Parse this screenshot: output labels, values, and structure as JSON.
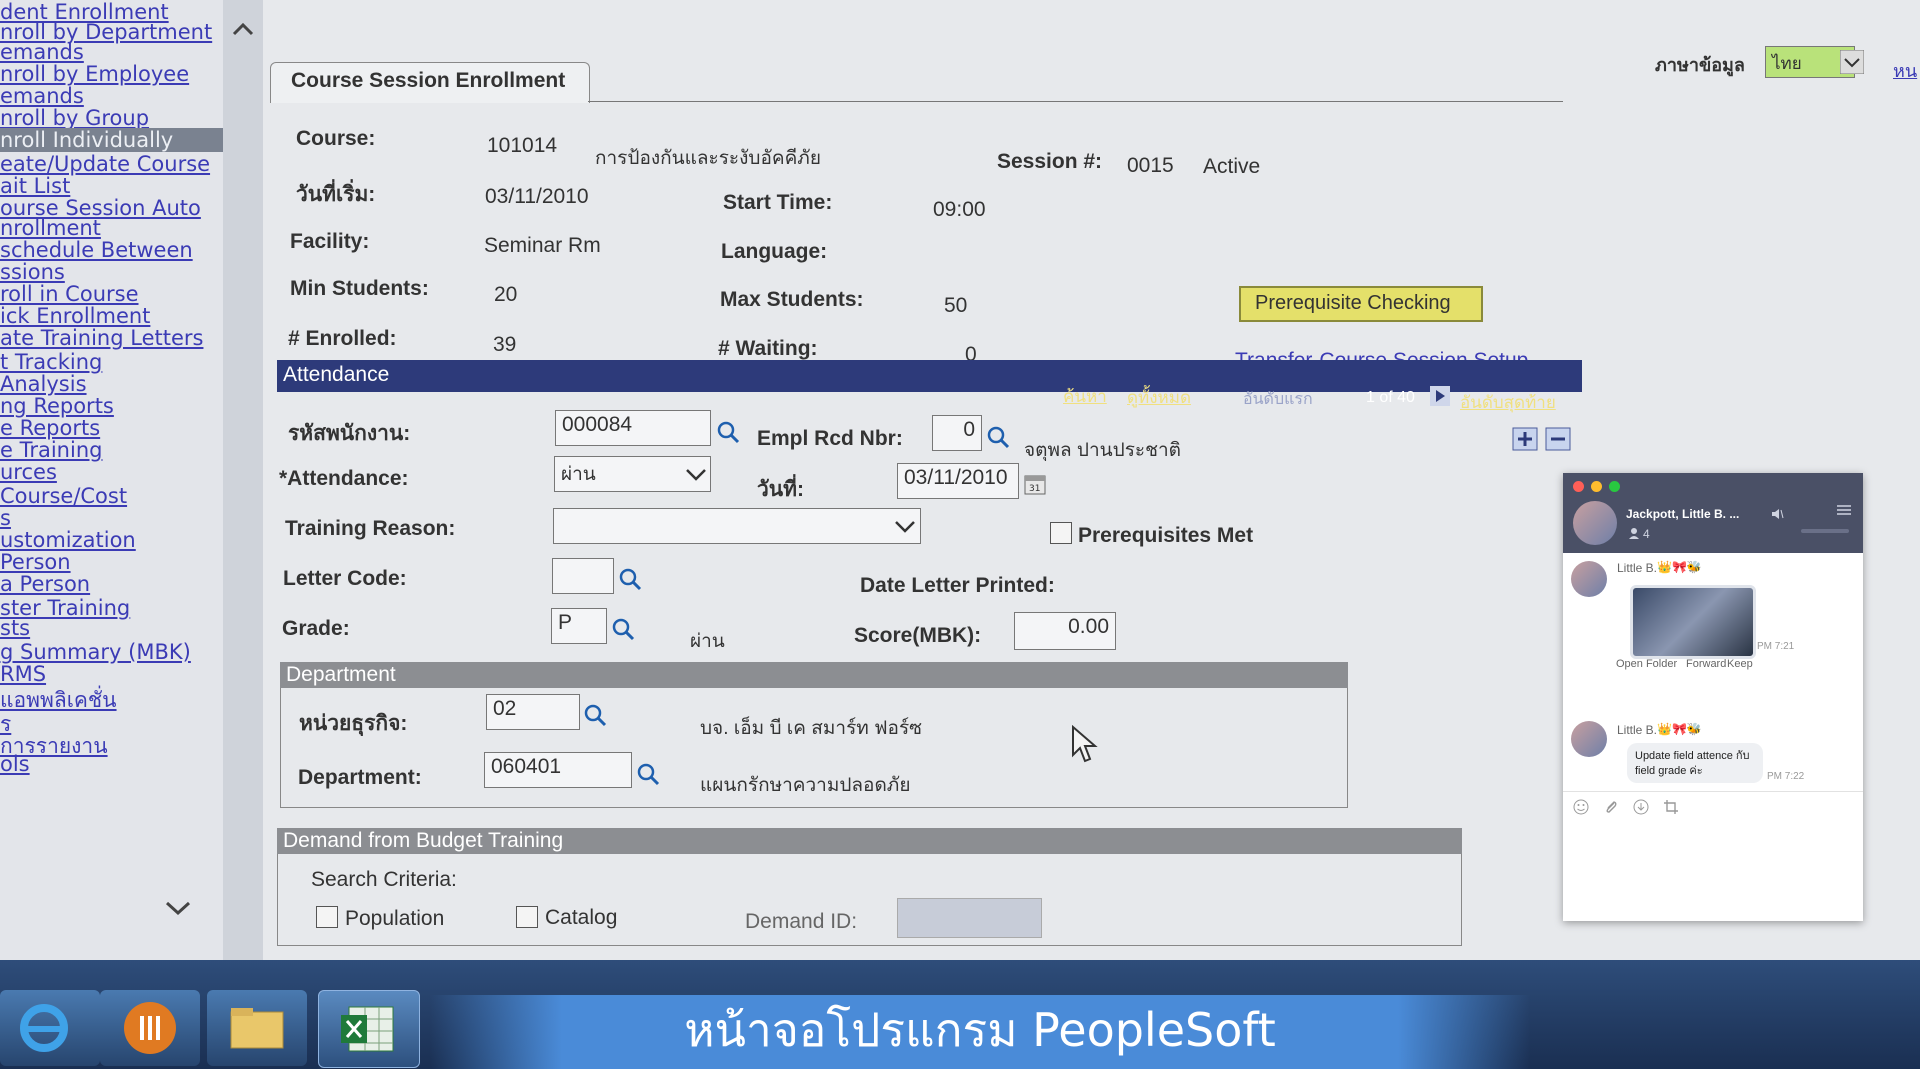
{
  "nav": {
    "items": [
      "dent Enrollment",
      "nroll by Department",
      "emands",
      "nroll by Employee",
      "emands",
      "nroll by Group",
      "nroll Individually",
      "eate/Update Course",
      "ait List",
      "ourse Session Auto",
      "nrollment",
      "schedule Between",
      "ssions",
      "roll in Course",
      "ick Enrollment",
      "ate Training Letters",
      "t Tracking",
      "Analysis",
      "ng Reports",
      "e Reports",
      "e Training",
      "urces",
      " Course/Cost",
      "s",
      "ustomization",
      "Person",
      "a Person",
      "ster Training",
      "sts",
      "g Summary (MBK)",
      "RMS",
      "แอพพลิเคชั่น",
      "ร",
      "การรายงาน",
      "ols"
    ],
    "selected_index": 6
  },
  "header": {
    "language_label": "ภาษาข้อมูล",
    "language_value": "ไทย",
    "corner_link": "หน"
  },
  "tab": {
    "label": "Course Session Enrollment"
  },
  "course": {
    "course_label": "Course:",
    "course_code": "101014",
    "course_name": "การป้องกันและระงับอัคคีภัย",
    "session_label": "Session #:",
    "session_value": "0015",
    "status": "Active",
    "start_date_label": "วันที่เริ่ม:",
    "start_date": "03/11/2010",
    "start_time_label": "Start Time:",
    "start_time": "09:00",
    "facility_label": "Facility:",
    "facility": "Seminar Rm",
    "language_label": "Language:",
    "min_label": "Min Students:",
    "min_value": "20",
    "max_label": "Max Students:",
    "max_value": "50",
    "enrolled_label": "# Enrolled:",
    "enrolled_value": "39",
    "waiting_label": "# Waiting:",
    "waiting_value": "0",
    "prereq_button": "Prerequisite Checking",
    "transfer_link": "Transfer-Course Session Setup"
  },
  "attendance": {
    "bar_title": "Attendance",
    "find": "ค้นหา",
    "view_all": "ดูทั้งหมด",
    "first": "อันดับแรก",
    "pager": "1 of 40",
    "last": "อันดับสุดท้าย",
    "emp_label": "รหัสพนักงาน:",
    "emp_value": "000084",
    "rcd_label": "Empl Rcd Nbr:",
    "rcd_value": "0",
    "emp_name": "จตุพล ปานประชาติ",
    "att_label": "*Attendance:",
    "att_value": "ผ่าน",
    "date_label": "วันที่:",
    "date_value": "03/11/2010",
    "reason_label": "Training Reason:",
    "reason_value": "",
    "prereq_met_label": "Prerequisites Met",
    "letter_label": "Letter Code:",
    "letter_value": "",
    "date_printed_label": "Date Letter Printed:",
    "grade_label": "Grade:",
    "grade_value": "P",
    "grade_desc": "ผ่าน",
    "score_label": "Score(MBK):",
    "score_value": "0.00"
  },
  "department": {
    "bar_title": "Department",
    "unit_label": "หน่วยธุรกิจ:",
    "unit_value": "02",
    "unit_name": "บจ. เอ็ม บี เค สมาร์ท ฟอร์ซ",
    "dept_label": "Department:",
    "dept_value": "060401",
    "dept_name": "แผนกรักษาความปลอดภัย"
  },
  "demand": {
    "bar_title": "Demand from Budget Training",
    "search_label": "Search Criteria:",
    "population_label": "Population",
    "catalog_label": "Catalog",
    "demand_id_label": "Demand ID:"
  },
  "chat": {
    "title": "Jackpott, Little B. ...",
    "members": "4",
    "sender1": "Little B.",
    "time1": "PM 7:21",
    "actions": [
      "Open Folder",
      "Forward",
      "Keep"
    ],
    "sender2": "Little B.",
    "message2": "Update field attence กับ field grade ค่ะ",
    "time2": "PM 7:22"
  },
  "caption": "หน้าจอโปรแกรม PeopleSoft",
  "colors": {
    "bar_blue": "#2d3a7a",
    "bar_gray": "#8c8e92",
    "prereq_button": "#e4e06a",
    "caption_bg": "#4a8bd8"
  }
}
